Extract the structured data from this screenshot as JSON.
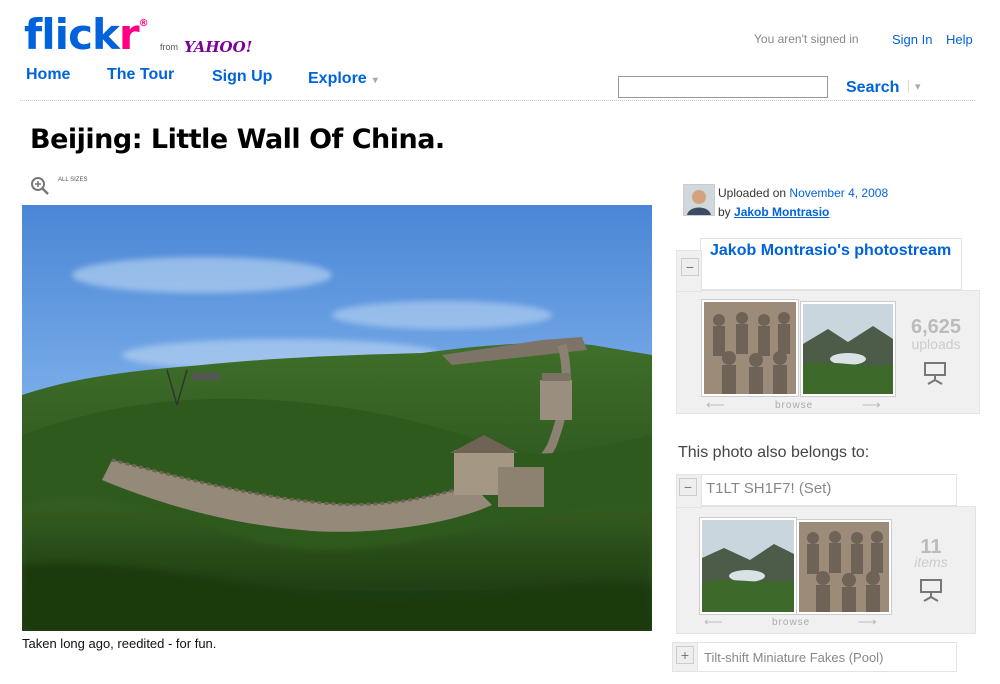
{
  "header": {
    "logo_text": "flickr",
    "from_label": "from",
    "yahoo_label": "YAHOO!",
    "signed_status": "You aren't signed in",
    "sign_in": "Sign In",
    "help": "Help"
  },
  "nav": {
    "home": "Home",
    "tour": "The Tour",
    "signup": "Sign Up",
    "explore": "Explore",
    "arrow": "▾"
  },
  "search": {
    "placeholder": "",
    "value": "",
    "button": "Search",
    "arrow": "▾"
  },
  "photo": {
    "title": "Beijing: Little Wall Of China.",
    "all_sizes": "ALL SIZES",
    "caption": "Taken long ago, reedited - for fun."
  },
  "sidebar": {
    "uploaded_label": "Uploaded on",
    "uploaded_date": "November 4, 2008",
    "by_label": "by",
    "author": "Jakob Montrasio",
    "photostream_title": "Jakob Montrasio's photostream",
    "uploads_count": "6,625",
    "uploads_label": "uploads",
    "browse": "browse",
    "belongs_label": "This photo also belongs to:",
    "set_title": "T1LT SH1F7! (Set)",
    "set_count": "11",
    "set_count_label": "items",
    "pool_title": "Tilt-shift Miniature Fakes (Pool)",
    "minus": "−",
    "plus": "+",
    "left_arrow": "⟵",
    "right_arrow": "⟶"
  },
  "colors": {
    "flickr_blue": "#0063dc",
    "flickr_pink": "#ff0084",
    "yahoo_purple": "#7b0099"
  }
}
